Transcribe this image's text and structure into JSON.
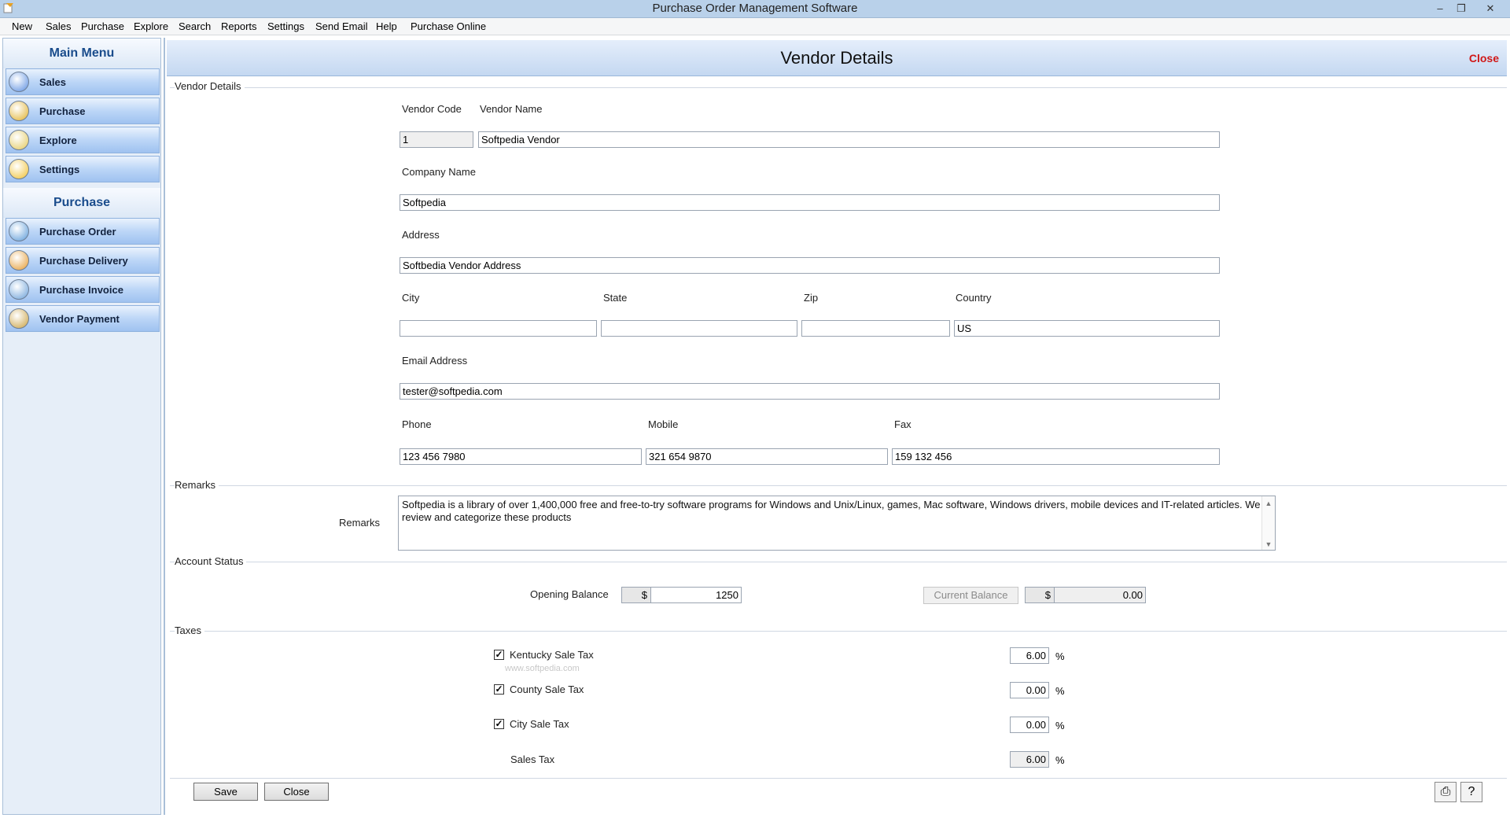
{
  "window": {
    "title": "Purchase Order Management Software",
    "controls": {
      "minimize": "–",
      "restore": "❐",
      "close": "✕"
    }
  },
  "menu": [
    "New",
    "Sales",
    "Purchase",
    "Explore",
    "Search",
    "Reports",
    "Settings",
    "Send Email",
    "Help",
    "Purchase Online"
  ],
  "sidebar": {
    "main_header": "Main Menu",
    "main_items": [
      {
        "label": "Sales",
        "icon": "sales-chart-icon",
        "color": "#5a8ee0"
      },
      {
        "label": "Purchase",
        "icon": "purchase-box-icon",
        "color": "#e0b02a"
      },
      {
        "label": "Explore",
        "icon": "explore-icon",
        "color": "#e2c85a"
      },
      {
        "label": "Settings",
        "icon": "settings-icon",
        "color": "#f0c030"
      }
    ],
    "section_header": "Purchase",
    "section_items": [
      {
        "label": "Purchase Order",
        "icon": "purchase-order-icon",
        "color": "#5a9ad8"
      },
      {
        "label": "Purchase Delivery",
        "icon": "purchase-delivery-icon",
        "color": "#e49a30"
      },
      {
        "label": "Purchase Invoice",
        "icon": "purchase-invoice-icon",
        "color": "#6aa0d8"
      },
      {
        "label": "Vendor Payment",
        "icon": "vendor-payment-icon",
        "color": "#c9a040"
      }
    ]
  },
  "page": {
    "title": "Vendor Details",
    "close_link": "Close"
  },
  "vendor": {
    "group_label": "Vendor Details",
    "code_label": "Vendor Code",
    "code_value": "1",
    "name_label": "Vendor Name",
    "name_value": "Softpedia Vendor",
    "company_label": "Company Name",
    "company_value": "Softpedia",
    "address_label": "Address",
    "address_value": "Softbedia Vendor Address",
    "city_label": "City",
    "city_value": "",
    "state_label": "State",
    "state_value": "",
    "zip_label": "Zip",
    "zip_value": "",
    "country_label": "Country",
    "country_value": "US",
    "email_label": "Email Address",
    "email_value": "tester@softpedia.com",
    "phone_label": "Phone",
    "phone_value": "123 456 7980",
    "mobile_label": "Mobile",
    "mobile_value": "321 654 9870",
    "fax_label": "Fax",
    "fax_value": "159 132 456"
  },
  "remarks": {
    "group_label": "Remarks",
    "field_label": "Remarks",
    "text": "Softpedia is a library of over 1,400,000 free and free-to-try software programs for Windows and Unix/Linux, games, Mac software, Windows drivers, mobile devices and IT-related articles. We review and categorize these products"
  },
  "account": {
    "group_label": "Account Status",
    "opening_label": "Opening Balance",
    "currency": "$",
    "opening_value": "1250",
    "current_button": "Current Balance",
    "current_value": "0.00"
  },
  "taxes": {
    "group_label": "Taxes",
    "items": [
      {
        "label": "Kentucky Sale Tax",
        "checked": true,
        "value": "6.00"
      },
      {
        "label": "County Sale Tax",
        "checked": true,
        "value": "0.00"
      },
      {
        "label": "City Sale Tax",
        "checked": true,
        "value": "0.00"
      }
    ],
    "sales_tax_label": "Sales Tax",
    "sales_tax_value": "6.00",
    "percent": "%"
  },
  "watermark": "www.softpedia.com",
  "footer": {
    "save": "Save",
    "close": "Close",
    "print_icon": "printer-icon",
    "help_icon": "help-icon"
  }
}
